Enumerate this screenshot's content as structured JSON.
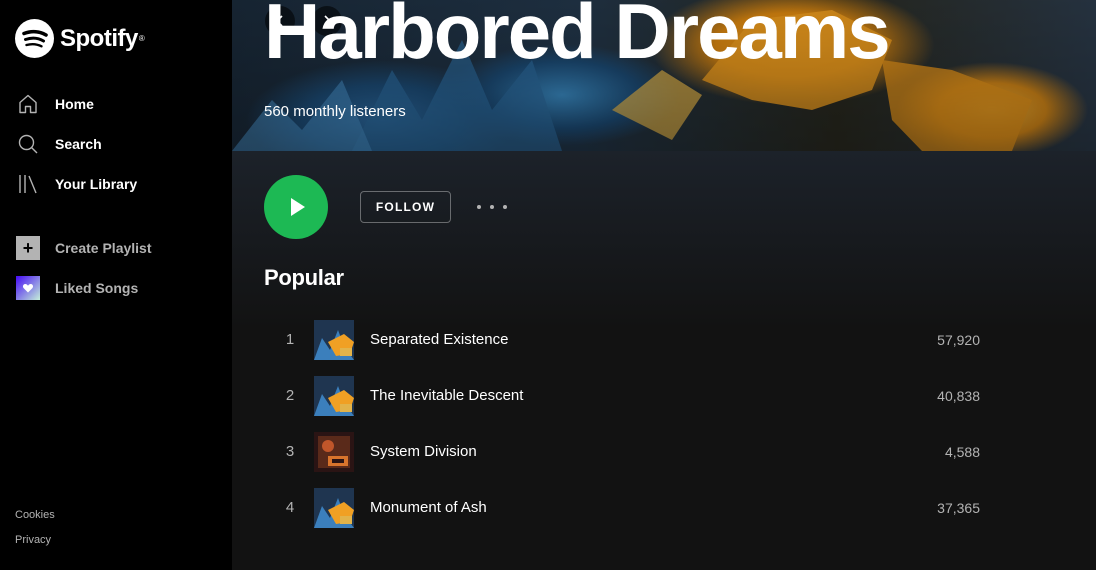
{
  "app": {
    "name": "Spotify"
  },
  "sidebar": {
    "nav": [
      {
        "label": "Home",
        "icon": "home-icon"
      },
      {
        "label": "Search",
        "icon": "search-icon"
      },
      {
        "label": "Your Library",
        "icon": "library-icon"
      }
    ],
    "actions": [
      {
        "label": "Create Playlist",
        "icon": "plus-icon"
      },
      {
        "label": "Liked Songs",
        "icon": "heart-icon"
      }
    ],
    "footer": {
      "cookies": "Cookies",
      "privacy": "Privacy"
    }
  },
  "artist": {
    "name": "Harbored Dreams",
    "listeners": "560 monthly listeners"
  },
  "controls": {
    "follow_label": "FOLLOW"
  },
  "popular": {
    "title": "Popular",
    "tracks": [
      {
        "rank": "1",
        "title": "Separated Existence",
        "plays": "57,920",
        "art": "blue-orange"
      },
      {
        "rank": "2",
        "title": "The Inevitable Descent",
        "plays": "40,838",
        "art": "blue-orange"
      },
      {
        "rank": "3",
        "title": "System Division",
        "plays": "4,588",
        "art": "red-dark"
      },
      {
        "rank": "4",
        "title": "Monument of Ash",
        "plays": "37,365",
        "art": "blue-orange"
      }
    ]
  },
  "colors": {
    "accent": "#1db954",
    "sidebar_bg": "#000000",
    "main_bg": "#121212",
    "muted_text": "#b3b3b3"
  }
}
